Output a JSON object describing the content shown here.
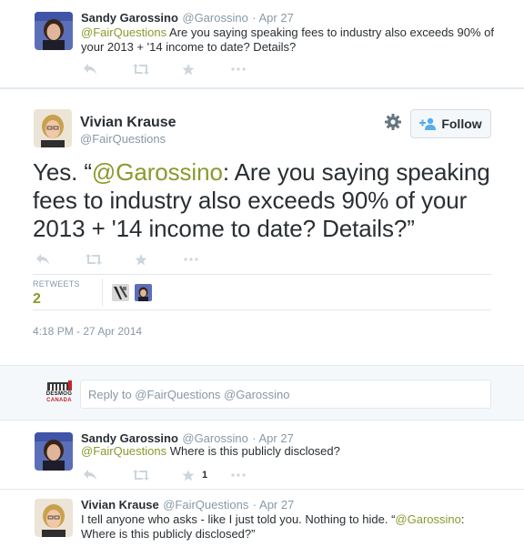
{
  "tweets": [
    {
      "name": "Sandy Garossino",
      "handle": "@Garossino",
      "time": "· Apr 27",
      "mention": "@FairQuestions",
      "text": " Are you saying speaking fees to industry also exceeds 90% of your 2013 + '14 income to date? Details?"
    },
    {
      "name": "Sandy Garossino",
      "handle": "@Garossino",
      "time": "· Apr 27",
      "mention": "@FairQuestions",
      "text": " Where is this publicly disclosed?",
      "favorite_count": "1"
    },
    {
      "name": "Vivian Krause",
      "handle": "@FairQuestions",
      "time": "· Apr 27",
      "text_before": "I tell anyone who asks - like I just told you. Nothing to hide. “",
      "mention": "@Garossino",
      "text_after": ": Where is this publicly disclosed?”"
    }
  ],
  "main_tweet": {
    "name": "Vivian Krause",
    "handle": "@FairQuestions",
    "follow_label": "Follow",
    "text_before": "Yes. “",
    "mention": "@Garossino",
    "text_after": ": Are you saying speaking fees to industry also exceeds 90% of your 2013 + '14 income to date? Details?”",
    "retweets_label": "RETWEETS",
    "retweets_count": "2",
    "timestamp": "4:18 PM - 27 Apr 2014"
  },
  "reply": {
    "placeholder": "Reply to @FairQuestions @Garossino",
    "logo_text": [
      "DESMOG",
      "CANADA"
    ]
  },
  "colors": {
    "mention": "#8a9a2e",
    "action_icon": "#ccd6dd",
    "border": "#e1e8ed",
    "reply_bg": "#f5f8fa"
  },
  "icons": [
    "reply-icon",
    "retweet-icon",
    "favorite-icon",
    "more-icon",
    "gear-icon",
    "follow-person-icon"
  ]
}
